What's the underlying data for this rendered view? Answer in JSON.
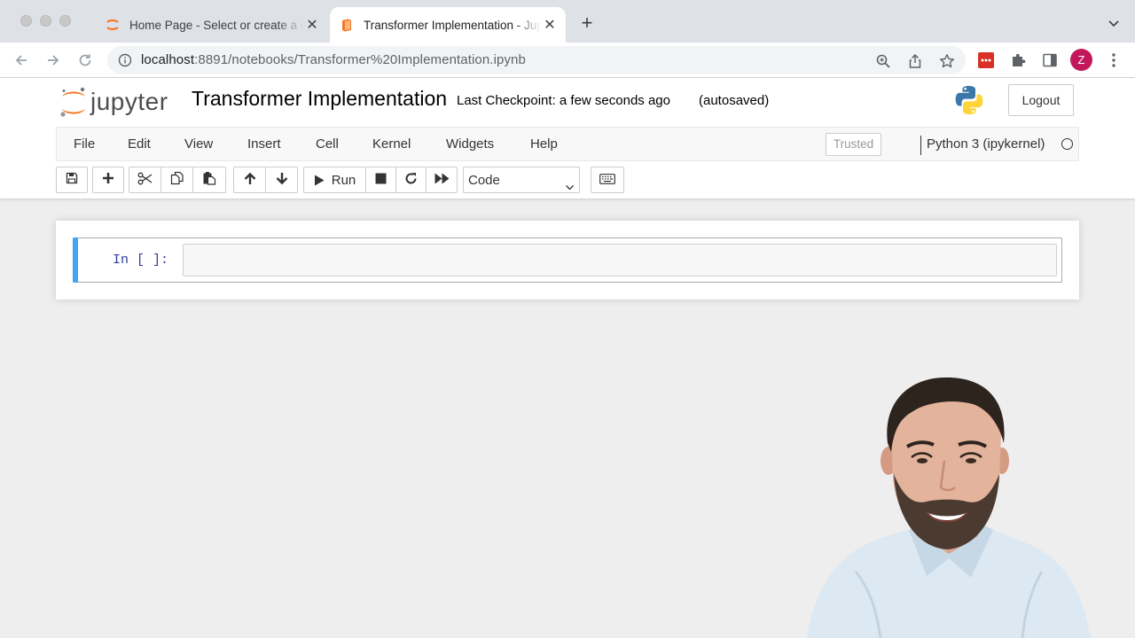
{
  "browser": {
    "tabs": [
      {
        "title": "Home Page - Select or create a notebook",
        "active": false
      },
      {
        "title": "Transformer Implementation - Jupyter Notebook",
        "active": true
      }
    ],
    "url_host": "localhost",
    "url_path": ":8891/notebooks/Transformer%20Implementation.ipynb",
    "profile_initial": "Z",
    "colors": {
      "tab_bar": "#dee1e6",
      "profile": "#c2185b",
      "jupyter_orange": "#f37726"
    }
  },
  "jupyter": {
    "logo_text": "jupyter",
    "notebook_name": "Transformer Implementation",
    "checkpoint": "Last Checkpoint: a few seconds ago",
    "autosave": "(autosaved)",
    "logout": "Logout",
    "menu": [
      "File",
      "Edit",
      "View",
      "Insert",
      "Cell",
      "Kernel",
      "Widgets",
      "Help"
    ],
    "trusted": "Trusted",
    "kernel": "Python 3 (ipykernel)",
    "toolbar": {
      "run_label": "Run",
      "cell_type": "Code"
    },
    "cell": {
      "prompt": "In [ ]:",
      "content": ""
    },
    "colors": {
      "selected_cell_bar": "#42a5f5",
      "prompt": "#303f9f"
    }
  }
}
